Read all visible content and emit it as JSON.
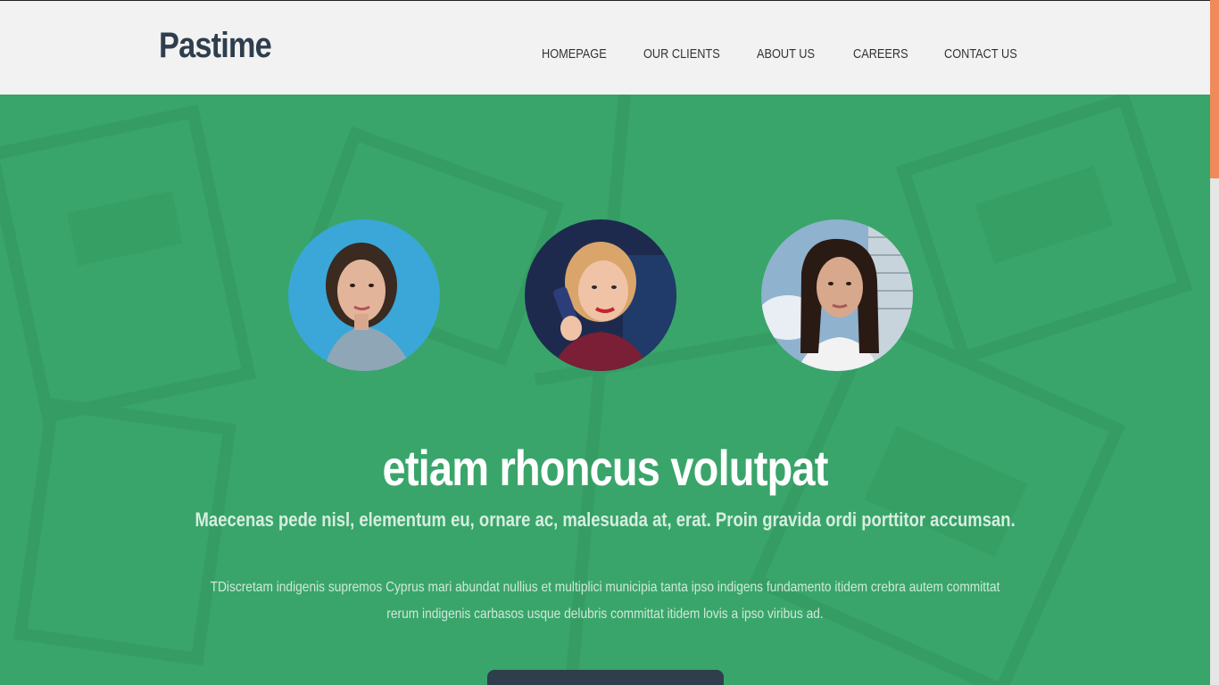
{
  "site": {
    "logo": "Pastime"
  },
  "nav": {
    "items": [
      {
        "label": "HOMEPAGE"
      },
      {
        "label": "OUR CLIENTS"
      },
      {
        "label": "ABOUT US"
      },
      {
        "label": "CAREERS"
      },
      {
        "label": "CONTACT US"
      }
    ]
  },
  "hero": {
    "title": "etiam rhoncus volutpat",
    "subtitle": "Maecenas pede nisl, elementum eu, ornare ac, malesuada at, erat. Proin gravida ordi porttitor accumsan.",
    "body": "TDiscretam indigenis supremos Cyprus mari abundat nullius et multiplici municipia tanta ipso indigens fundamento itidem crebra autem committat rerum indigenis carbasos usque delubris committat itidem lovis a ipso viribus ad.",
    "background_color": "#3aa56a",
    "button_color": "#2f3e4c"
  },
  "colors": {
    "header_bg": "#f2f2f2",
    "logo": "#2f3e4c",
    "scroll_thumb": "#ef8a5a"
  }
}
